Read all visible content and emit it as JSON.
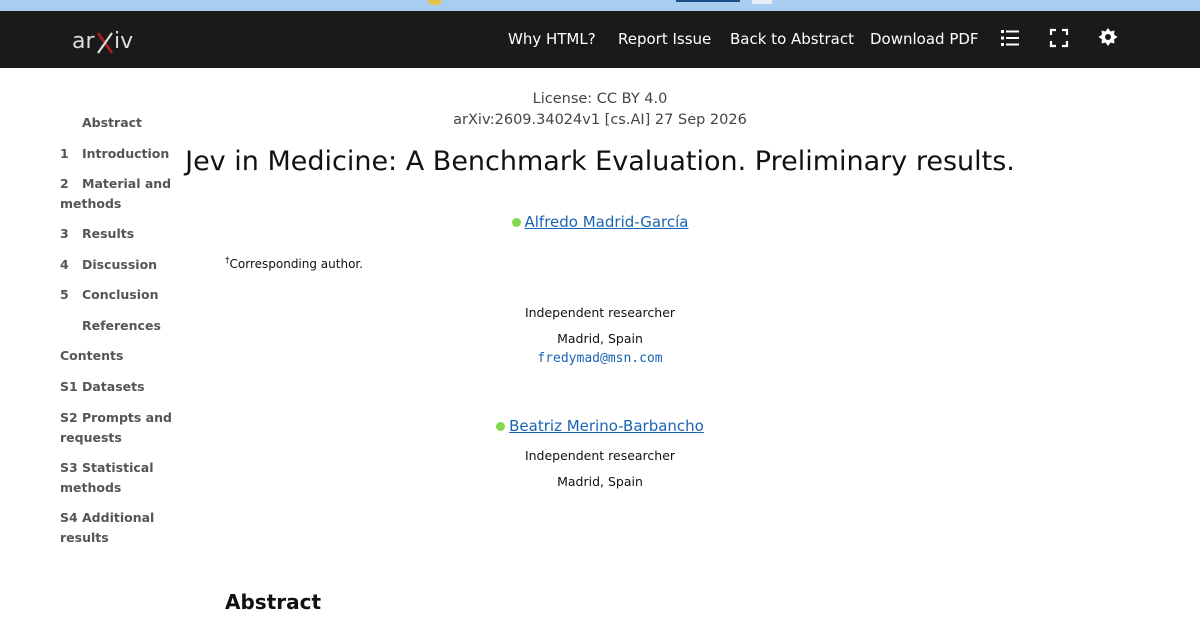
{
  "browser": {
    "colors": {
      "strip": "#a9cdf0"
    }
  },
  "navbar": {
    "logo_text": "arXiv",
    "links": {
      "why_html": "Why HTML?",
      "report_issue": "Report Issue",
      "back_to_abstract": "Back to Abstract",
      "download_pdf": "Download PDF"
    },
    "icons": [
      "list-icon",
      "fullscreen-icon",
      "theme-gear-icon"
    ],
    "colors": {
      "background": "#1a1a1a",
      "text": "#ffffff",
      "logo_accent": "#b31b1b"
    }
  },
  "toc": {
    "items": [
      {
        "num": "",
        "label": "Abstract"
      },
      {
        "num": "1",
        "label": "Introduction"
      },
      {
        "num": "2",
        "label": "Material and",
        "label2": "methods"
      },
      {
        "num": "3",
        "label": "Results"
      },
      {
        "num": "4",
        "label": "Discussion"
      },
      {
        "num": "5",
        "label": "Conclusion"
      },
      {
        "num": "",
        "label": "References"
      },
      {
        "num": "",
        "label": "Contents"
      },
      {
        "num": "S1",
        "label": "Datasets"
      },
      {
        "num": "S2",
        "label": "Prompts and",
        "label2": "requests"
      },
      {
        "num": "S3",
        "label": "Statistical",
        "label2": "methods"
      },
      {
        "num": "S4",
        "label": "Additional results"
      }
    ]
  },
  "paper": {
    "license": "License: CC BY 4.0",
    "arxiv_id": "arXiv:2609.34024v1 [cs.AI] 27 Sep 2026",
    "title": "Jev in Medicine: A Benchmark Evaluation. Preliminary results.",
    "authors": [
      {
        "name": "Alfredo Madrid-García",
        "affiliation": "Independent researcher",
        "location": "Madrid, Spain",
        "email": "fredymad@msn.com"
      },
      {
        "name": "Beatriz Merino-Barbancho",
        "affiliation": "Independent researcher",
        "location": "Madrid, Spain"
      }
    ],
    "footnote_mark": "†",
    "footnote": "Corresponding author.",
    "abstract_heading": "Abstract"
  },
  "colors": {
    "link": "#1a64b5",
    "orcid_dot": "#88d84f"
  }
}
